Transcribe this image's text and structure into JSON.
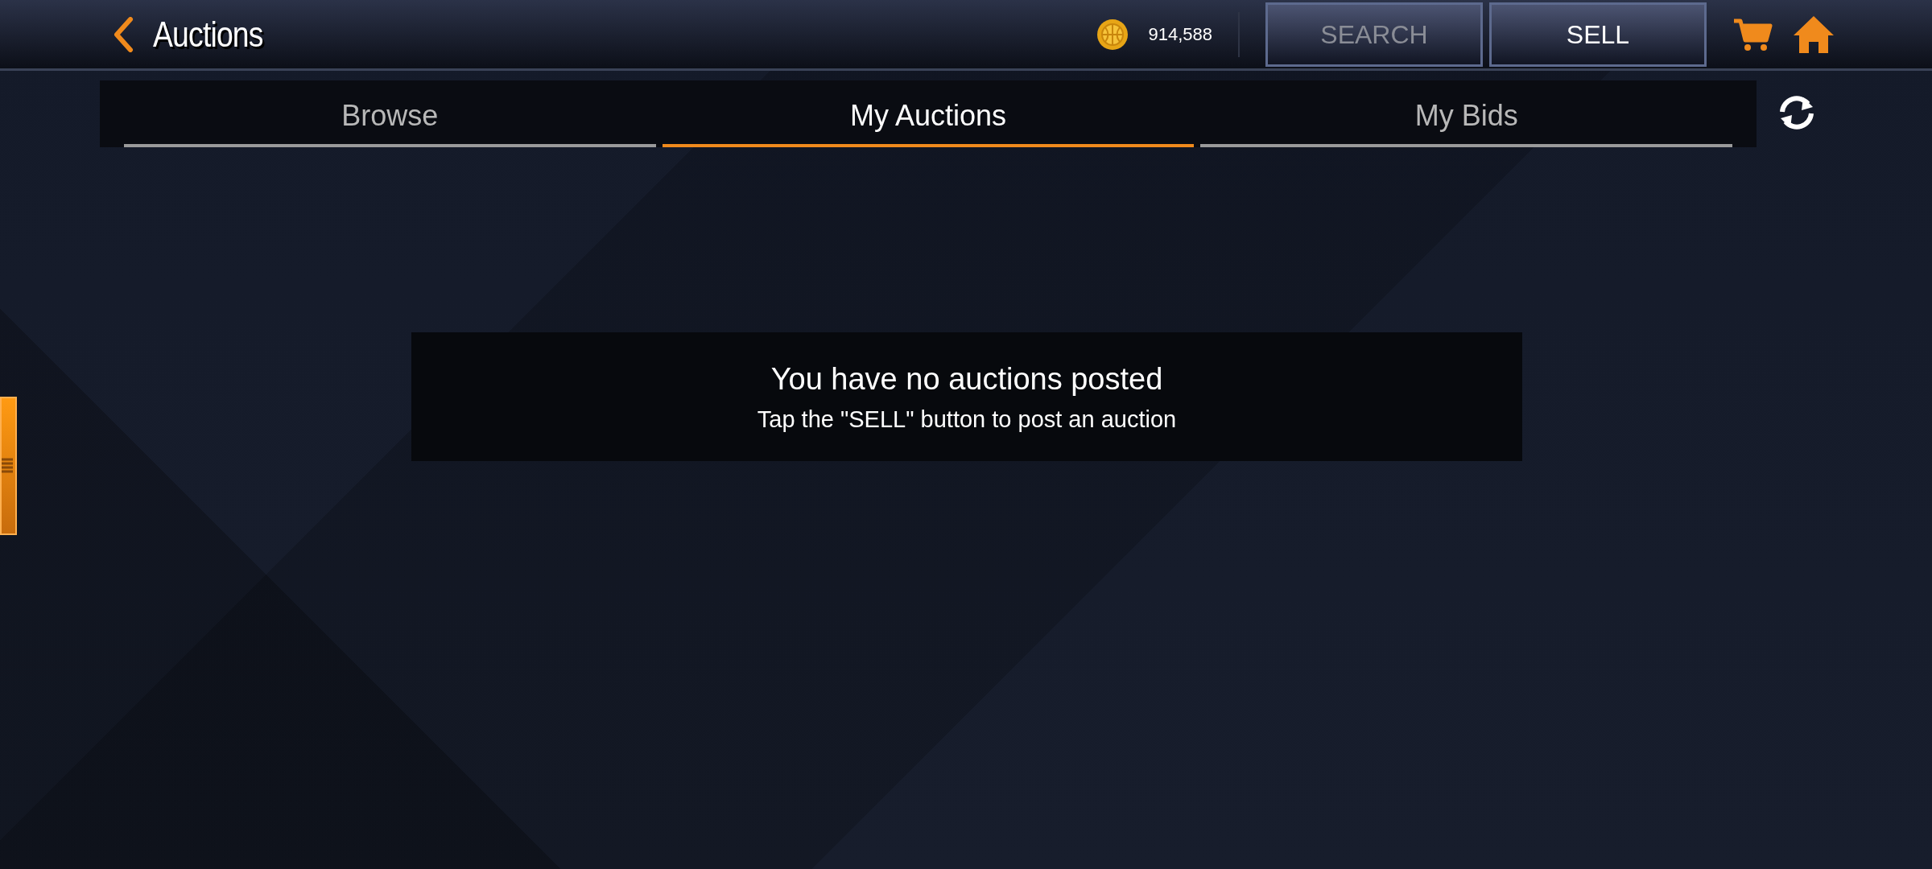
{
  "header": {
    "title": "Auctions",
    "coins": "914,588"
  },
  "buttons": [
    {
      "label": "SEARCH",
      "disabled": true
    },
    {
      "label": "SELL",
      "disabled": false
    }
  ],
  "tabs": [
    {
      "label": "Browse",
      "selected": false
    },
    {
      "label": "My Auctions",
      "selected": true
    },
    {
      "label": "My Bids",
      "selected": false
    }
  ],
  "message": {
    "title": "You have no auctions posted",
    "text": "Tap the \"SELL\" button to post an auction"
  }
}
